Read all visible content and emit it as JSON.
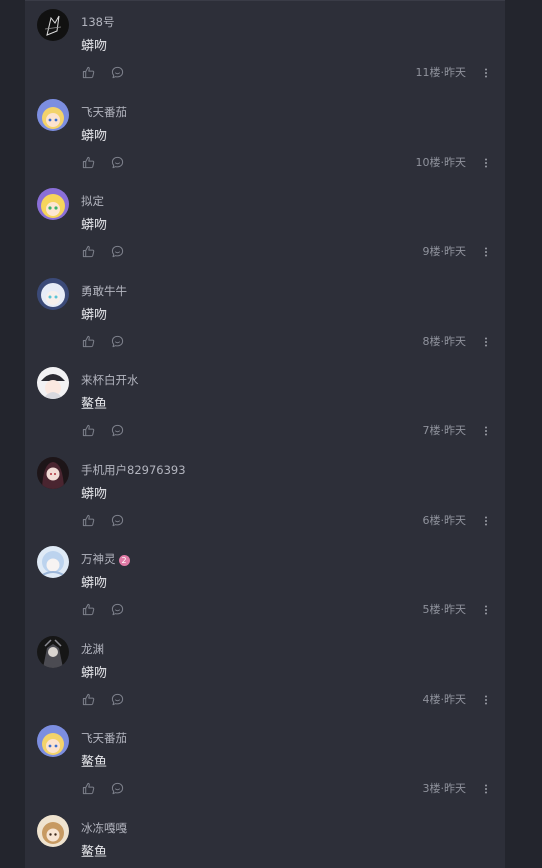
{
  "comments": [
    {
      "username": "138号",
      "content": "蟒吻",
      "floor": "11楼",
      "time": "昨天",
      "avatar": "dark-sketch-avatar",
      "badge": ""
    },
    {
      "username": "飞天番茄",
      "content": "蟒吻",
      "floor": "10楼",
      "time": "昨天",
      "avatar": "blonde-anime-avatar",
      "badge": ""
    },
    {
      "username": "拟定",
      "content": "蟒吻",
      "floor": "9楼",
      "time": "昨天",
      "avatar": "yellow-anime-avatar",
      "badge": ""
    },
    {
      "username": "勇敢牛牛",
      "content": "蟒吻",
      "floor": "8楼",
      "time": "昨天",
      "avatar": "white-hair-anime-avatar",
      "badge": ""
    },
    {
      "username": "来杯白开水",
      "content": "鳌鱼",
      "floor": "7楼",
      "time": "昨天",
      "avatar": "white-cap-anime-avatar",
      "badge": ""
    },
    {
      "username": "手机用户82976393",
      "content": "蟒吻",
      "floor": "6楼",
      "time": "昨天",
      "avatar": "dark-hair-anime-avatar",
      "badge": ""
    },
    {
      "username": "万神灵",
      "content": "蟒吻",
      "floor": "5楼",
      "time": "昨天",
      "avatar": "light-blue-anime-avatar",
      "badge": "2"
    },
    {
      "username": "龙渊",
      "content": "蟒吻",
      "floor": "4楼",
      "time": "昨天",
      "avatar": "dark-armor-anime-avatar",
      "badge": ""
    },
    {
      "username": "飞天番茄",
      "content": "鳌鱼",
      "floor": "3楼",
      "time": "昨天",
      "avatar": "blonde-anime-avatar",
      "badge": ""
    },
    {
      "username": "冰冻嘎嘎",
      "content": "鳌鱼",
      "floor": "",
      "time": "",
      "avatar": "beige-anime-avatar",
      "badge": ""
    }
  ],
  "separator": "·",
  "icons": {
    "like": "thumbs-up-icon",
    "reply": "comment-bubble-icon",
    "more": "vertical-dots-icon"
  },
  "colors": {
    "background": "#23252d",
    "panel": "#2d2f39",
    "username": "#b3b5bf",
    "content": "#e3e4e8",
    "meta": "#8f929c",
    "icon": "#7d808b",
    "badge": "#e07ba6"
  }
}
